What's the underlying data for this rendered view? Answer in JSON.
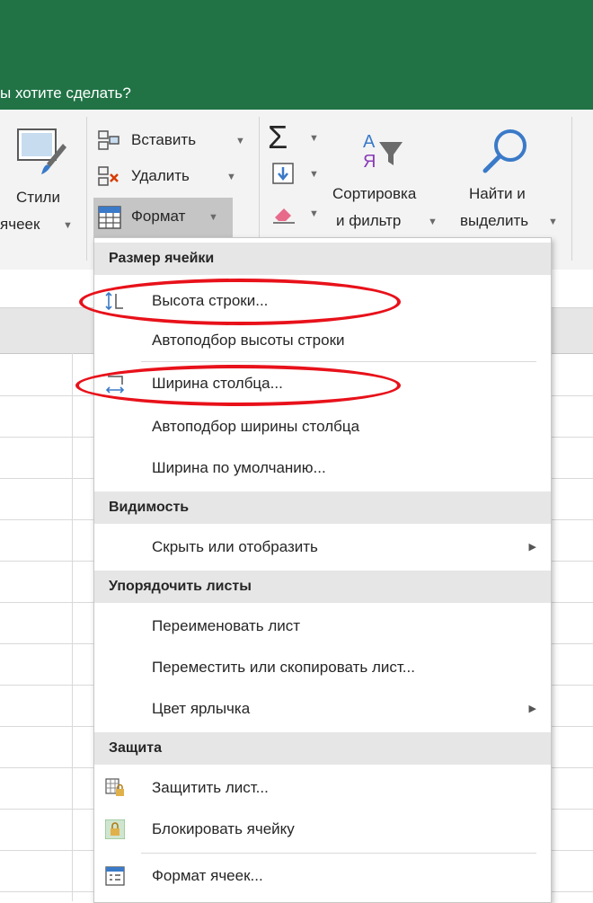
{
  "tellme": {
    "text": "ы хотите сделать?"
  },
  "ribbon": {
    "styles": {
      "line1": "Стили",
      "line2": "ячеек"
    },
    "insert_label": "Вставить",
    "delete_label": "Удалить",
    "format_label": "Формат",
    "sort": {
      "line1": "Сортировка",
      "line2": "и фильтр"
    },
    "find": {
      "line1": "Найти и",
      "line2": "выделить"
    }
  },
  "menu": {
    "section_size": "Размер ячейки",
    "row_height": "Высота строки...",
    "autofit_row": "Автоподбор высоты строки",
    "col_width": "Ширина столбца...",
    "autofit_col": "Автоподбор ширины столбца",
    "default_width": "Ширина по умолчанию...",
    "section_visibility": "Видимость",
    "hide_show": "Скрыть или отобразить",
    "section_sheets": "Упорядочить листы",
    "rename_sheet": "Переименовать лист",
    "move_copy": "Переместить или скопировать лист...",
    "tab_color": "Цвет ярлычка",
    "section_protect": "Защита",
    "protect_sheet": "Защитить лист...",
    "lock_cell": "Блокировать ячейку",
    "format_cells": "Формат ячеек..."
  },
  "colors": {
    "excel_green": "#217346",
    "highlight_red": "#e8111a"
  }
}
